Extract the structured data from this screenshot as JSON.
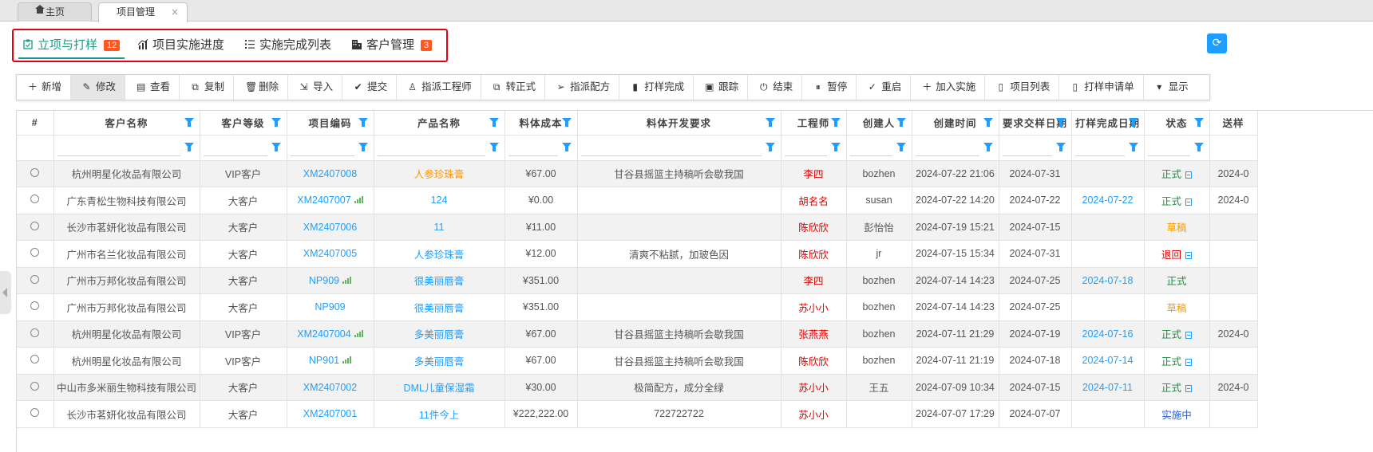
{
  "page_tabs": [
    {
      "label": "主页",
      "icon": "home-icon"
    },
    {
      "label": "项目管理",
      "close": "×"
    }
  ],
  "module_tabs": [
    {
      "label": "立项与打样",
      "badge": "12",
      "icon": "clipboard-icon",
      "active": true
    },
    {
      "label": "项目实施进度",
      "badge": "",
      "icon": "chart-icon"
    },
    {
      "label": "实施完成列表",
      "badge": "",
      "icon": "list-icon"
    },
    {
      "label": "客户管理",
      "badge": "3",
      "icon": "building-icon"
    }
  ],
  "refresh_icon": "⟳",
  "toolbar": [
    {
      "label": "新增",
      "icon": "＋",
      "name": "add"
    },
    {
      "label": "修改",
      "icon": "✎",
      "name": "edit"
    },
    {
      "label": "查看",
      "icon": "▤",
      "name": "view"
    },
    {
      "label": "复制",
      "icon": "⧉",
      "name": "copy"
    },
    {
      "label": "删除",
      "icon": "🗑",
      "name": "delete"
    },
    {
      "label": "导入",
      "icon": "⇲",
      "name": "import"
    },
    {
      "label": "提交",
      "icon": "✔",
      "name": "submit"
    },
    {
      "label": "指派工程师",
      "icon": "♙",
      "name": "assign-engineer"
    },
    {
      "label": "转正式",
      "icon": "⧉",
      "name": "to-formal"
    },
    {
      "label": "指派配方",
      "icon": "➢",
      "name": "assign-formula"
    },
    {
      "label": "打样完成",
      "icon": "▮",
      "name": "sample-done"
    },
    {
      "label": "跟踪",
      "icon": "▣",
      "name": "track"
    },
    {
      "label": "结束",
      "icon": "⏻",
      "name": "end"
    },
    {
      "label": "暂停",
      "icon": "⏸",
      "name": "pause"
    },
    {
      "label": "重启",
      "icon": "✓",
      "name": "restart"
    },
    {
      "label": "加入实施",
      "icon": "＋",
      "name": "join-implement"
    },
    {
      "label": "项目列表",
      "icon": "▯",
      "name": "project-list"
    },
    {
      "label": "打样申请单",
      "icon": "▯",
      "name": "sample-apply"
    },
    {
      "label": "显示",
      "icon": "▾",
      "name": "display"
    }
  ],
  "columns": [
    "#",
    "客户名称",
    "客户等级",
    "项目编码",
    "产品名称",
    "料体成本",
    "料体开发要求",
    "工程师",
    "创建人",
    "创建时间",
    "要求交样日期",
    "打样完成日期",
    "状态",
    "送样"
  ],
  "rows": [
    {
      "customer": "杭州明星化妆品有限公司",
      "level": "VIP客户",
      "code": "XM2407008",
      "code_chart": false,
      "product": "人参珍珠膏",
      "product_color": "orange",
      "cost": "¥67.00",
      "req": "甘谷县摇篮主持稿听会歇我国",
      "engineer": "李四",
      "creator": "bozhen",
      "created": "2024-07-22 21:06",
      "due": "2024-07-31",
      "done": "",
      "status": "正式",
      "status_color": "green",
      "status_doc": true,
      "send": "2024-0"
    },
    {
      "customer": "广东青松生物科技有限公司",
      "level": "大客户",
      "code": "XM2407007",
      "code_chart": true,
      "product": "124",
      "product_color": "link",
      "cost": "¥0.00",
      "req": "",
      "engineer": "胡名名",
      "creator": "susan",
      "created": "2024-07-22 14:20",
      "due": "2024-07-22",
      "done": "2024-07-22",
      "status": "正式",
      "status_color": "green",
      "status_doc": true,
      "send": "2024-0"
    },
    {
      "customer": "长沙市茗妍化妆品有限公司",
      "level": "大客户",
      "code": "XM2407006",
      "code_chart": false,
      "product": "11",
      "product_color": "link",
      "cost": "¥11.00",
      "req": "",
      "engineer": "陈欣欣",
      "creator": "彭怡怡",
      "created": "2024-07-19 15:21",
      "due": "2024-07-15",
      "done": "",
      "status": "草稿",
      "status_color": "orange",
      "status_doc": false,
      "send": ""
    },
    {
      "customer": "广州市名兰化妆品有限公司",
      "level": "大客户",
      "code": "XM2407005",
      "code_chart": false,
      "product": "人参珍珠膏",
      "product_color": "link",
      "cost": "¥12.00",
      "req": "清爽不粘腻，加玻色因",
      "engineer": "陈欣欣",
      "creator": "jr",
      "created": "2024-07-15 15:34",
      "due": "2024-07-31",
      "done": "",
      "status": "退回",
      "status_color": "red",
      "status_doc": true,
      "send": ""
    },
    {
      "customer": "广州市万邦化妆品有限公司",
      "level": "大客户",
      "code": "NP909",
      "code_chart": true,
      "product": "很美丽唇膏",
      "product_color": "link",
      "cost": "¥351.00",
      "req": "",
      "engineer": "李四",
      "creator": "bozhen",
      "created": "2024-07-14 14:23",
      "due": "2024-07-25",
      "done": "2024-07-18",
      "status": "正式",
      "status_color": "green",
      "status_doc": false,
      "send": ""
    },
    {
      "customer": "广州市万邦化妆品有限公司",
      "level": "大客户",
      "code": "NP909",
      "code_chart": false,
      "product": "很美丽唇膏",
      "product_color": "link",
      "cost": "¥351.00",
      "req": "",
      "engineer": "苏小小",
      "creator": "bozhen",
      "created": "2024-07-14 14:23",
      "due": "2024-07-25",
      "done": "",
      "status": "草稿",
      "status_color": "orange",
      "status_doc": false,
      "send": ""
    },
    {
      "customer": "杭州明星化妆品有限公司",
      "level": "VIP客户",
      "code": "XM2407004",
      "code_chart": true,
      "product": "多美丽唇膏",
      "product_color": "link",
      "cost": "¥67.00",
      "req": "甘谷县摇篮主持稿听会歇我国",
      "engineer": "张燕燕",
      "creator": "bozhen",
      "created": "2024-07-11 21:29",
      "due": "2024-07-19",
      "done": "2024-07-16",
      "status": "正式",
      "status_color": "green",
      "status_doc": true,
      "send": "2024-0"
    },
    {
      "customer": "杭州明星化妆品有限公司",
      "level": "VIP客户",
      "code": "NP901",
      "code_chart": true,
      "product": "多美丽唇膏",
      "product_color": "link",
      "cost": "¥67.00",
      "req": "甘谷县摇篮主持稿听会歇我国",
      "engineer": "陈欣欣",
      "creator": "bozhen",
      "created": "2024-07-11 21:19",
      "due": "2024-07-18",
      "done": "2024-07-14",
      "status": "正式",
      "status_color": "green",
      "status_doc": true,
      "send": ""
    },
    {
      "customer": "中山市多米丽生物科技有限公司",
      "level": "大客户",
      "code": "XM2407002",
      "code_chart": false,
      "product": "DML儿童保湿霜",
      "product_color": "link",
      "cost": "¥30.00",
      "req": "极简配方，成分全绿",
      "engineer": "苏小小",
      "creator": "王五",
      "created": "2024-07-09 10:34",
      "due": "2024-07-15",
      "done": "2024-07-11",
      "status": "正式",
      "status_color": "green",
      "status_doc": true,
      "send": "2024-0"
    },
    {
      "customer": "长沙市茗妍化妆品有限公司",
      "level": "大客户",
      "code": "XM2407001",
      "code_chart": false,
      "product": "11件今上",
      "product_color": "link",
      "cost": "¥222,222.00",
      "req": "722722722",
      "engineer": "苏小小",
      "creator": "",
      "created": "2024-07-07 17:29",
      "due": "2024-07-07",
      "done": "",
      "status": "实施中",
      "status_color": "blue",
      "status_doc": false,
      "send": ""
    }
  ]
}
